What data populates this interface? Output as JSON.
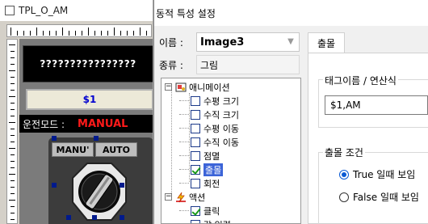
{
  "editor": {
    "title": "TPL_O_AM",
    "display_text": "????????????????",
    "dollar_label": "$1",
    "mode_label": "운전모드 :",
    "mode_value": "MANUAL",
    "manual_button": "MANU'",
    "auto_button": "AUTO"
  },
  "dialog": {
    "title": "동적 특성 설정",
    "name_label": "이름 :",
    "name_value": "Image3",
    "kind_label": "종류 :",
    "kind_value": "그림",
    "tree": {
      "animation_group": "애니메이션",
      "animation_items": [
        {
          "label": "수평 크기",
          "checked": false
        },
        {
          "label": "수직 크기",
          "checked": false
        },
        {
          "label": "수평 이동",
          "checked": false
        },
        {
          "label": "수직 이동",
          "checked": false
        },
        {
          "label": "점멸",
          "checked": false
        },
        {
          "label": "출몰",
          "checked": true
        },
        {
          "label": "회전",
          "checked": false
        }
      ],
      "action_group": "액션",
      "action_items": [
        {
          "label": "클릭",
          "checked": true
        },
        {
          "label": "값 입력",
          "checked": false
        }
      ]
    },
    "tab_label": "출몰",
    "tag_group_title": "태그이름 / 연산식",
    "tag_value": "$1,AM",
    "condition_group_title": "출몰 조건",
    "option_true": "True 일때 보임",
    "option_false": "False 일때 보임",
    "selected_option": "true"
  }
}
